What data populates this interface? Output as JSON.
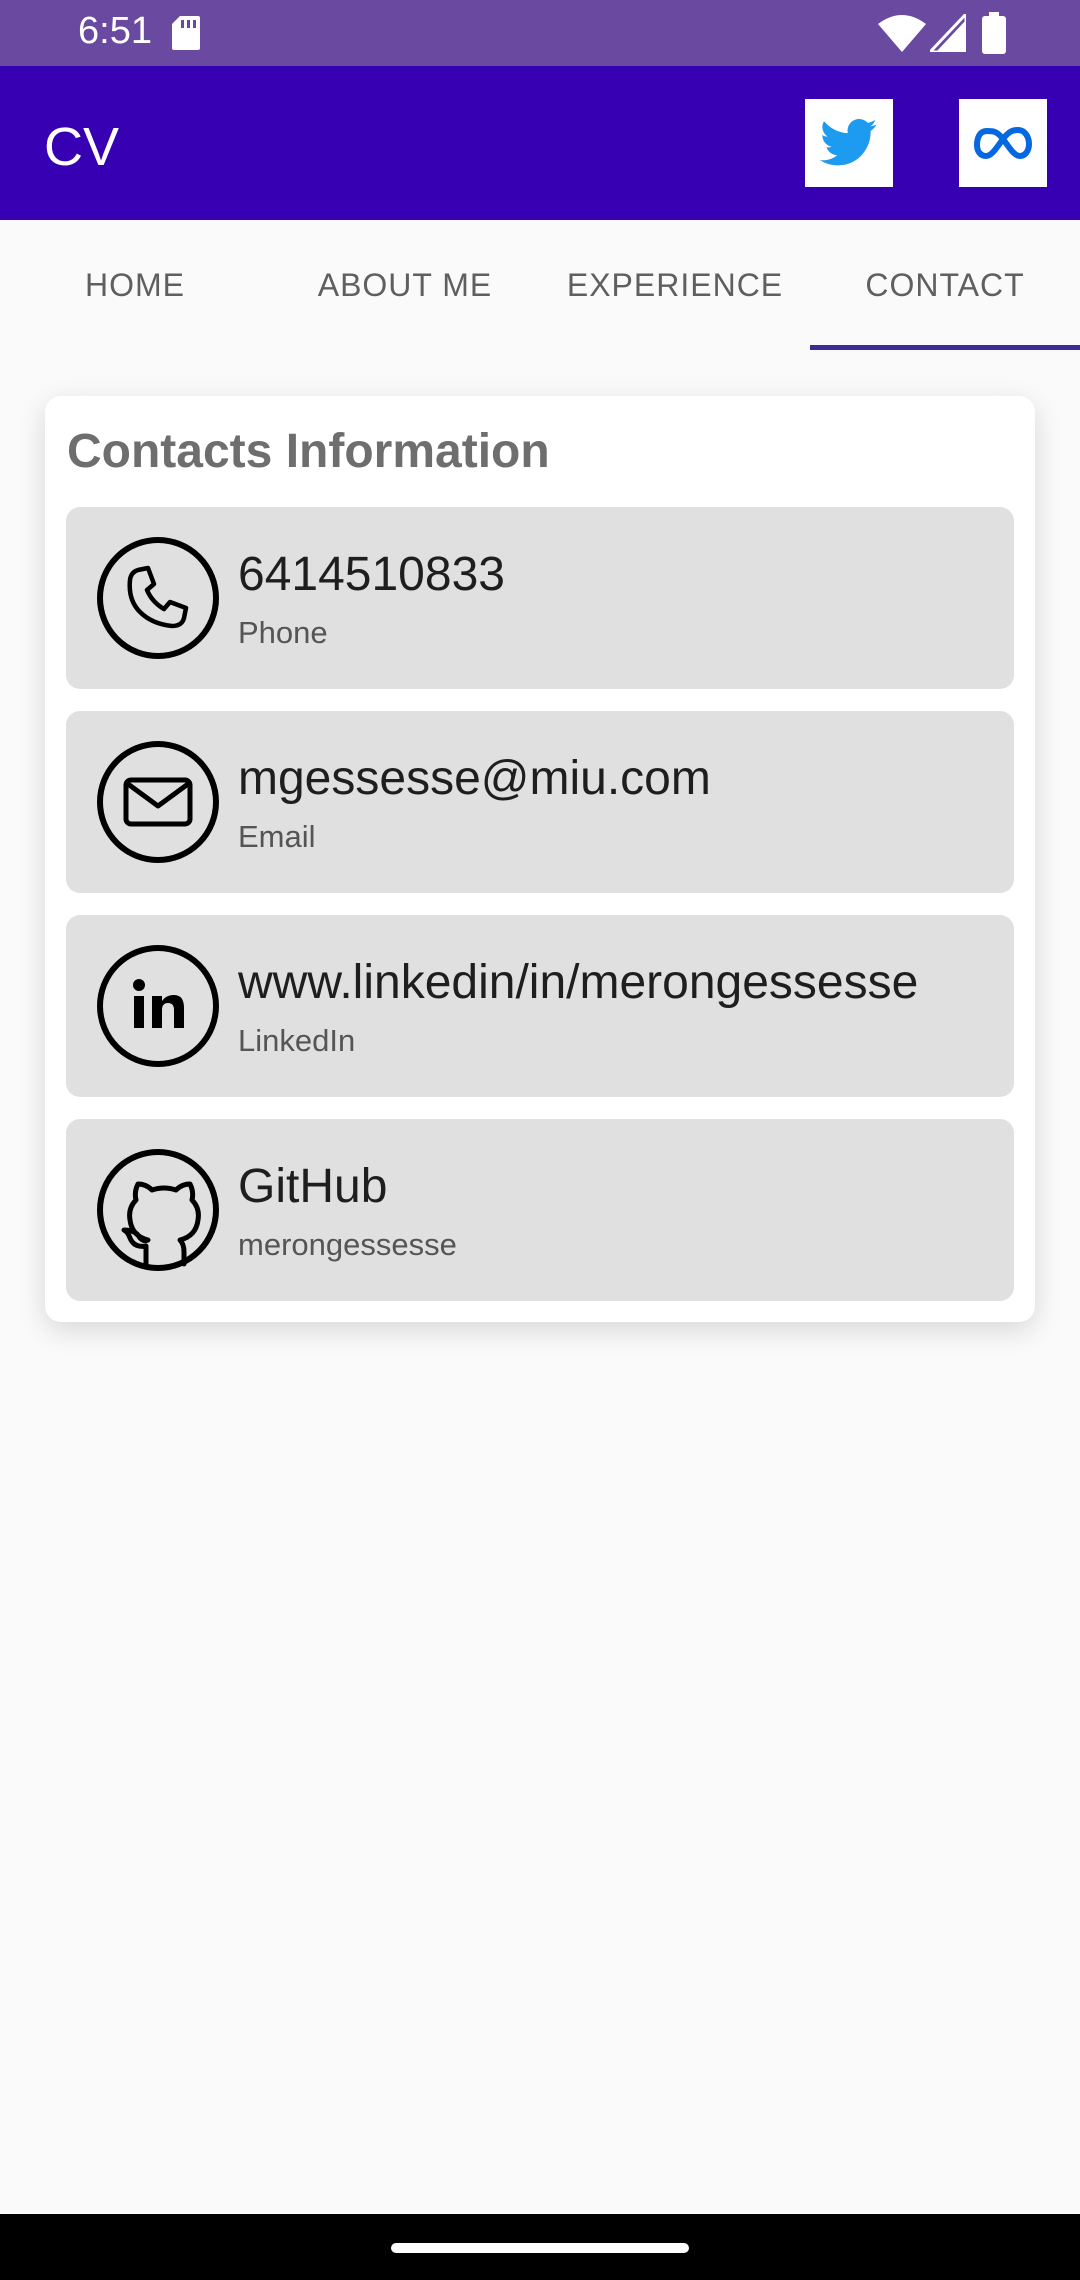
{
  "status_bar": {
    "time": "6:51"
  },
  "app_bar": {
    "title": "CV"
  },
  "tabs": [
    {
      "label": "HOME"
    },
    {
      "label": "ABOUT ME"
    },
    {
      "label": "EXPERIENCE"
    },
    {
      "label": "CONTACT"
    }
  ],
  "selected_tab": "CONTACT",
  "card": {
    "title": "Contacts Information",
    "items": [
      {
        "primary": "6414510833",
        "secondary": "Phone",
        "icon": "phone-icon"
      },
      {
        "primary": "mgessesse@miu.com",
        "secondary": "Email",
        "icon": "email-icon"
      },
      {
        "primary": "www.linkedin/in/merongessesse",
        "secondary": "LinkedIn",
        "icon": "linkedin-icon"
      },
      {
        "primary": "GitHub",
        "secondary": "merongessesse",
        "icon": "github-icon"
      }
    ]
  },
  "colors": {
    "app_bar": "#3700b3",
    "status_bar": "#6a4aa0",
    "tab_indicator": "#3f2b96",
    "twitter": "#1d9bf0",
    "meta": "#0668e1"
  }
}
